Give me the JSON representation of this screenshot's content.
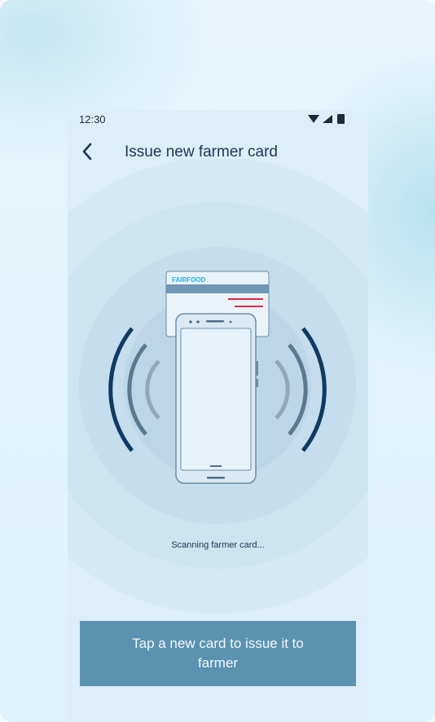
{
  "status": {
    "time": "12:30"
  },
  "header": {
    "title": "Issue new farmer card",
    "back_icon": "chevron-left-icon"
  },
  "card": {
    "brand": "FAIRFOOD"
  },
  "scan": {
    "status_text": "Scanning farmer card..."
  },
  "cta": {
    "label": "Tap a new card to issue it to farmer"
  },
  "colors": {
    "accent": "#5b92b0",
    "dark_wave": "#0f3a63",
    "brand_blue": "#1db3e6",
    "brand_red": "#e3264a"
  }
}
